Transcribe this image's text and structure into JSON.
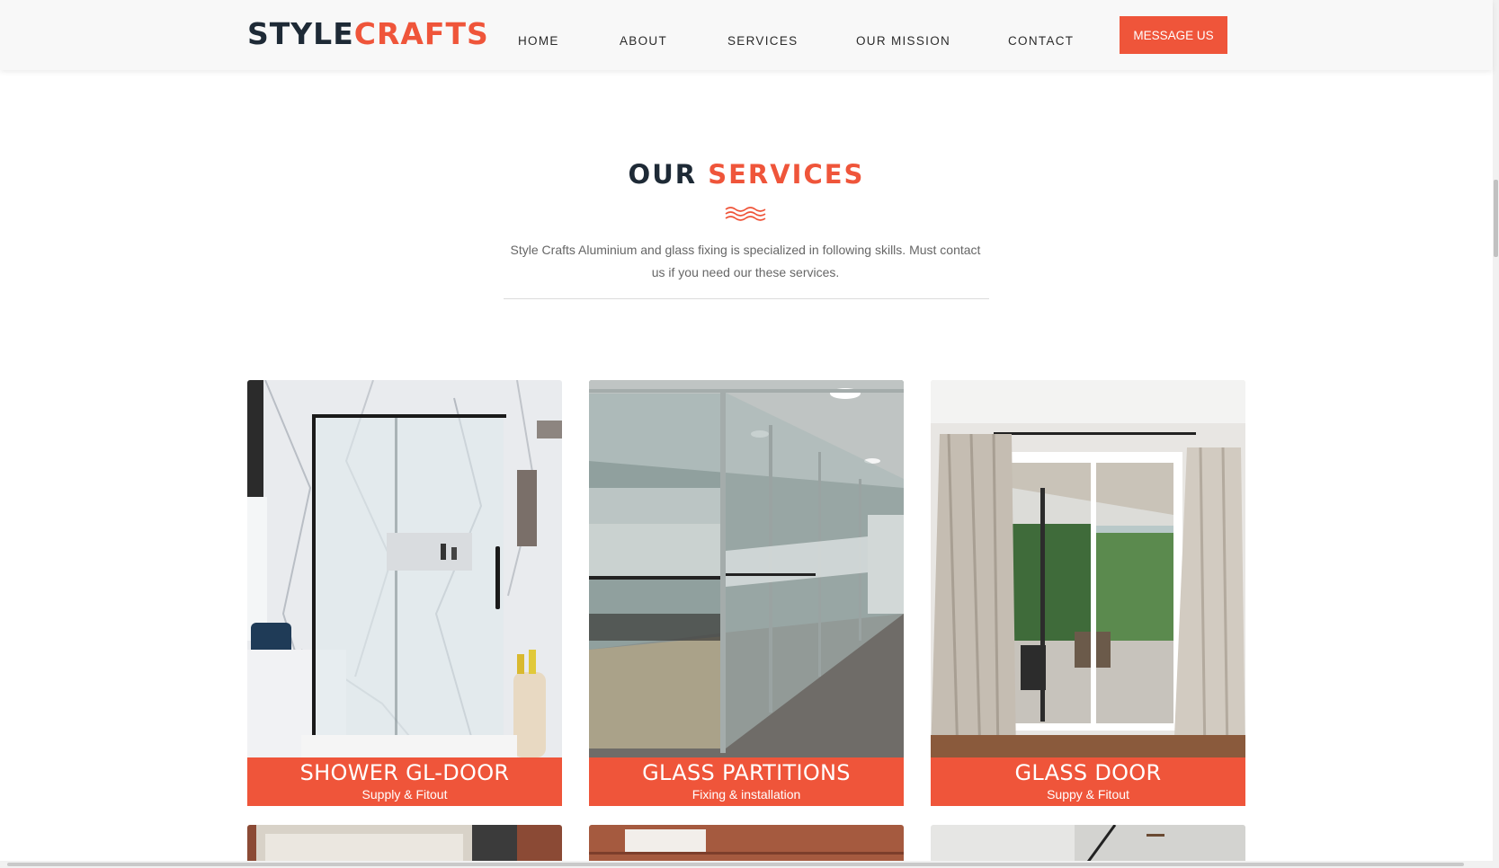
{
  "header": {
    "logo_dark": "STYLE",
    "logo_accent": "CRAFTS",
    "nav": [
      {
        "label": "HOME"
      },
      {
        "label": "ABOUT"
      },
      {
        "label": "SERVICES"
      },
      {
        "label": "OUR MISSION"
      },
      {
        "label": "CONTACT"
      }
    ],
    "cta_label": "MESSAGE US"
  },
  "services": {
    "title_dark": "OUR",
    "title_accent": "SERVICES",
    "description": "Style Crafts Aluminium and glass fixing is specialized in following skills. Must contact us if you need our these services.",
    "cards": [
      {
        "title": "SHOWER GL-DOOR",
        "subtitle": "Supply & Fitout"
      },
      {
        "title": "GLASS PARTITIONS",
        "subtitle": "Fixing & installation"
      },
      {
        "title": "GLASS DOOR",
        "subtitle": "Suppy & Fitout"
      }
    ]
  },
  "colors": {
    "accent": "#ef553a",
    "dark": "#1e2a36",
    "header_bg": "#f8f8f8",
    "body_text": "#666666"
  }
}
